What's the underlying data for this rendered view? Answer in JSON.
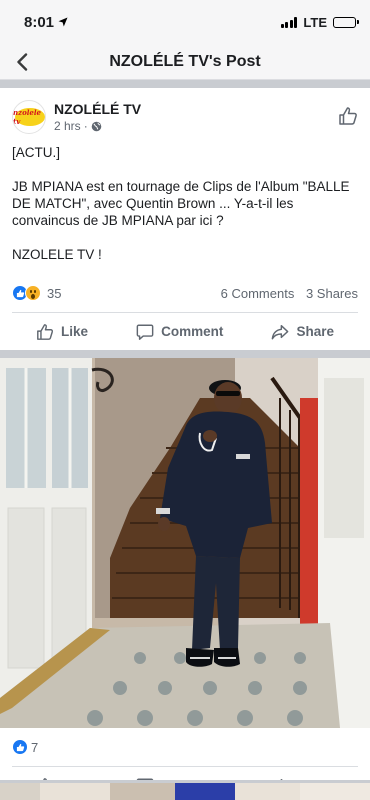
{
  "status_bar": {
    "time": "8:01",
    "carrier": "LTE",
    "battery_level": 0.9
  },
  "nav": {
    "title": "NZOLÉLÉ TV's Post"
  },
  "post": {
    "author": "NZOLÉLÉ TV",
    "avatar_text": "nzolele tv",
    "time": "2 hrs",
    "text_lines": [
      "[ACTU.]",
      "JB MPIANA est en tournage de Clips de l'Album \"BALLE DE MATCH\", avec Quentin Brown ...  Y-a-t-il les convaincus de JB MPIANA par ici ?",
      "NZOLELE TV !"
    ],
    "reaction_count": "35",
    "comments": "6 Comments",
    "shares": "3 Shares"
  },
  "actions": {
    "like": "Like",
    "comment": "Comment",
    "share": "Share"
  },
  "photo": {
    "reaction_count": "7"
  },
  "icons": {
    "back": "chevron-left-icon",
    "location": "location-arrow-icon",
    "globe": "globe-icon",
    "like": "thumbs-up-icon",
    "comment": "speech-bubble-icon",
    "share": "share-arrow-icon"
  },
  "colors": {
    "facebook_blue": "#1877f2",
    "wow_yellow": "#f7b125",
    "separator": "#c9ccd1"
  }
}
